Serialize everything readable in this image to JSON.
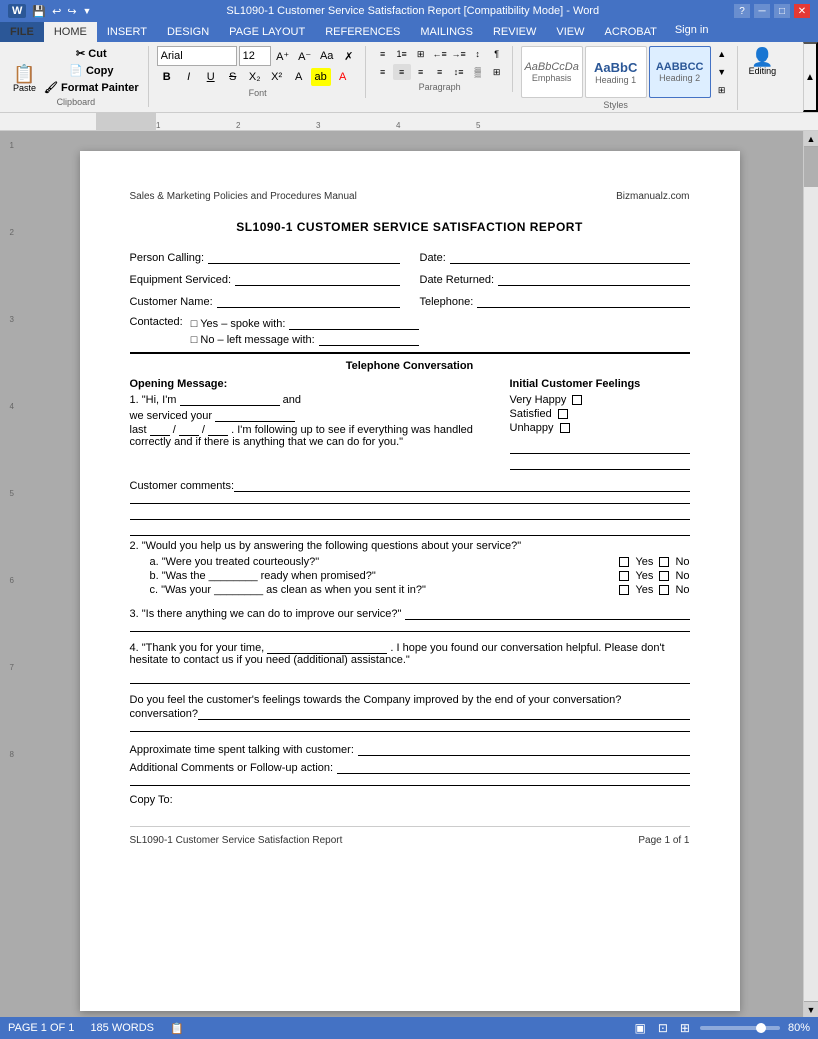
{
  "titleBar": {
    "title": "SL1090-1 Customer Service Satisfaction Report [Compatibility Mode] - Word",
    "appName": "Word",
    "helpBtn": "?",
    "minBtn": "─",
    "maxBtn": "□",
    "closeBtn": "✕"
  },
  "quickAccess": {
    "saveIcon": "💾",
    "undoIcon": "↩",
    "redoIcon": "↪"
  },
  "ribbonTabs": [
    {
      "label": "FILE",
      "active": false
    },
    {
      "label": "HOME",
      "active": true
    },
    {
      "label": "INSERT",
      "active": false
    },
    {
      "label": "DESIGN",
      "active": false
    },
    {
      "label": "PAGE LAYOUT",
      "active": false
    },
    {
      "label": "REFERENCES",
      "active": false
    },
    {
      "label": "MAILINGS",
      "active": false
    },
    {
      "label": "REVIEW",
      "active": false
    },
    {
      "label": "VIEW",
      "active": false
    },
    {
      "label": "ACROBAT",
      "active": false
    }
  ],
  "ribbon": {
    "fontName": "Arial",
    "fontSize": "12",
    "clipboardLabel": "Clipboard",
    "fontLabel": "Font",
    "paragraphLabel": "Paragraph",
    "stylesLabel": "Styles",
    "editingLabel": "Editing",
    "styles": [
      {
        "preview": "AaBbCcDa",
        "label": "Emphasis",
        "active": false
      },
      {
        "preview": "AaBbC",
        "label": "Heading 1",
        "active": false
      },
      {
        "preview": "AABBCC",
        "label": "Heading 2",
        "active": true
      }
    ],
    "editingBtn": "Editing"
  },
  "document": {
    "header": {
      "left": "Sales & Marketing Policies and Procedures Manual",
      "right": "Bizmanualz.com"
    },
    "title": "SL1090-1 CUSTOMER SERVICE SATISFACTION REPORT",
    "fields": {
      "personCalling": "Person Calling:",
      "date": "Date:",
      "equipmentServiced": "Equipment Serviced:",
      "dateReturned": "Date Returned:",
      "customerName": "Customer Name:",
      "telephone": "Telephone:",
      "contacted": "Contacted:",
      "yes": "□ Yes – spoke with:",
      "no": "□ No – left message with:"
    },
    "sectionTitle": "Telephone Conversation",
    "openingMessage": "Opening Message:",
    "greeting": "1. \"Hi, I'm",
    "and": "and",
    "weServiced": "we serviced your",
    "last": "last",
    "followUp": ". I'm following up to see if everything was handled correctly and if there is anything that we can do for you.\"",
    "initialFeelings": "Initial Customer Feelings",
    "veryHappy": "Very Happy",
    "satisfied": "Satisfied",
    "unhappy": "Unhappy",
    "customerComments": "Customer comments:",
    "q2": "2. \"Would you help us by answering the following questions about your service?\"",
    "q2a": "a. \"Were you treated courteously?\"",
    "q2b": "b. \"Was the ________ ready when promised?\"",
    "q2c": "c. \"Was your ________ as clean as when you sent it in?\"",
    "yes_label": "□ Yes",
    "no_label": "□ No",
    "q3": "3. \"Is there anything we can do to improve our service?\"",
    "q4start": "4. \"Thank you for your time,",
    "q4end": ". I hope you found our conversation helpful. Please don't hesitate to contact us if you need (additional) assistance.\"",
    "customerFeelings": "Do you feel the customer's feelings towards the Company improved by the end of your conversation?",
    "approxTime": "Approximate time spent talking with customer:",
    "additionalComments": "Additional Comments or Follow-up action:",
    "copyTo": "Copy To:"
  },
  "footer": {
    "left": "SL1090-1 Customer Service Satisfaction Report",
    "right": "Page 1 of 1"
  },
  "statusBar": {
    "page": "PAGE 1 OF 1",
    "words": "185 WORDS",
    "zoom": "80%"
  }
}
